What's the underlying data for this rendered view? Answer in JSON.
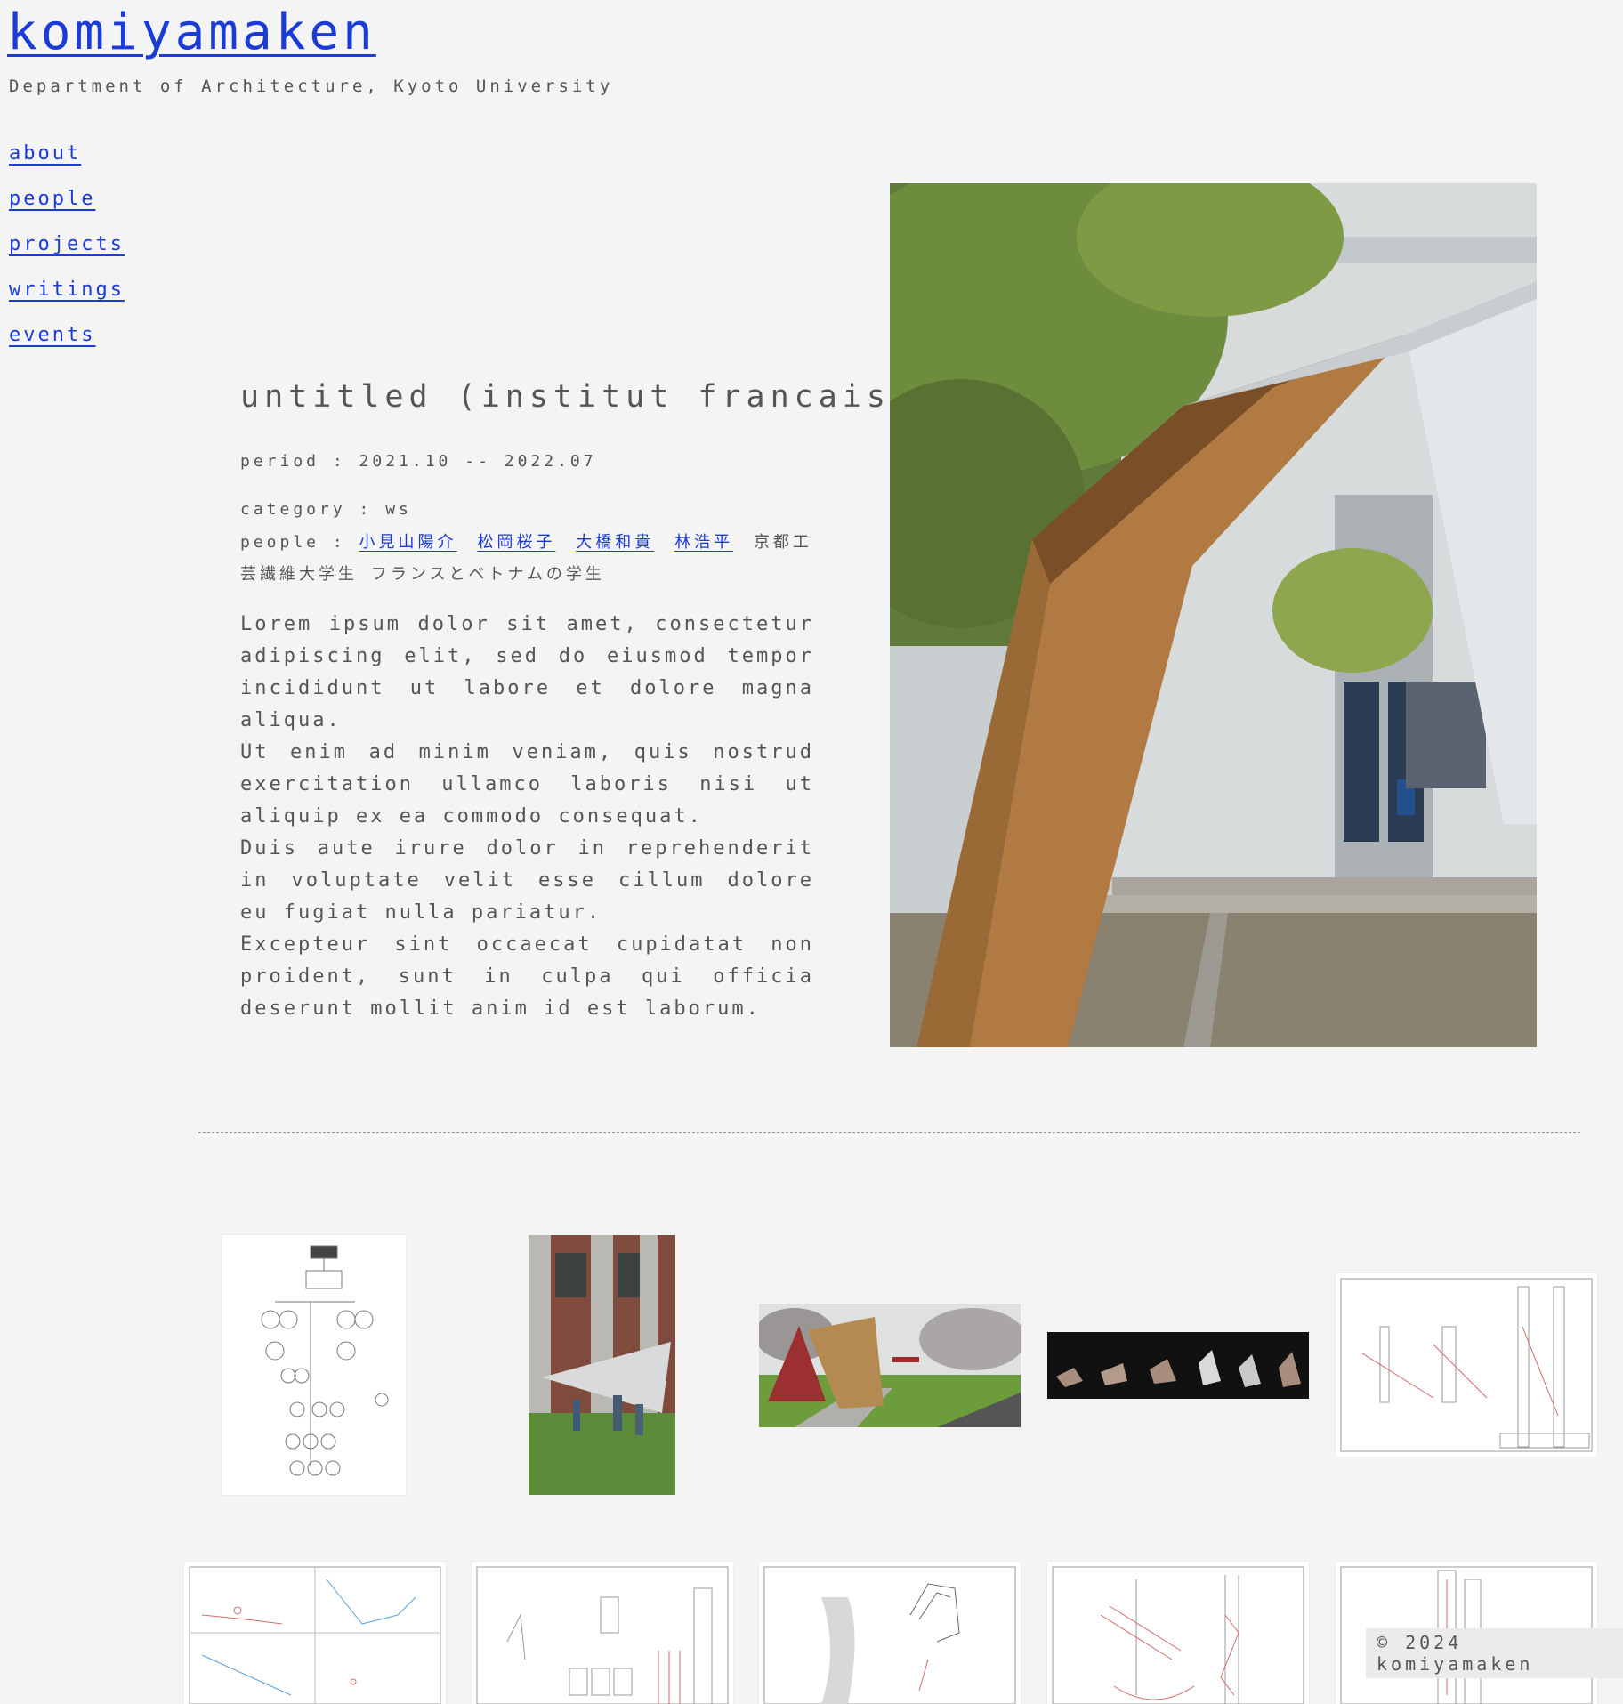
{
  "site": {
    "title": "komiyamaken",
    "subtitle": "Department of Architecture, Kyoto University"
  },
  "nav": {
    "items": [
      {
        "label": "about"
      },
      {
        "label": "people"
      },
      {
        "label": "projects"
      },
      {
        "label": "writings"
      },
      {
        "label": "events"
      }
    ]
  },
  "project": {
    "title": "untitled (institut francais)",
    "period": "period : 2021.10 -- 2022.07",
    "category": "category : ws",
    "people_label": "people : ",
    "people_links": [
      "小見山陽介",
      "松岡桜子",
      "大橋和貴",
      "林浩平"
    ],
    "people_extra": "京都工芸繊維大学生 フランスとベトナムの学生",
    "description": [
      "Lorem ipsum dolor sit amet, consectetur adipiscing elit, sed do eiusmod tempor incididunt ut labore et dolore magna aliqua.",
      "Ut enim ad minim veniam, quis nostrud exercitation ullamco laboris nisi ut aliquip ex ea commodo consequat.",
      "Duis aute irure dolor in reprehenderit in voluptate velit esse cillum dolore eu fugiat nulla pariatur.",
      "Excepteur sint occaecat cupidatat non proident, sunt in culpa qui officia deserunt mollit anim id est laborum."
    ]
  },
  "gallery": {
    "main_photo": "pavilion-photo",
    "thumbnails": [
      "diagram-drawing",
      "installation-photo",
      "rendering",
      "folding-study-strip",
      "elevation-drawing",
      "detail-drawing-1",
      "detail-drawing-2",
      "detail-drawing-3",
      "detail-drawing-4",
      "detail-drawing-5"
    ]
  },
  "footer": {
    "copyright": "© 2024 komiyamaken"
  },
  "colors": {
    "background": "#f4f4f4",
    "link": "#1a3bd6",
    "text": "#555555"
  }
}
